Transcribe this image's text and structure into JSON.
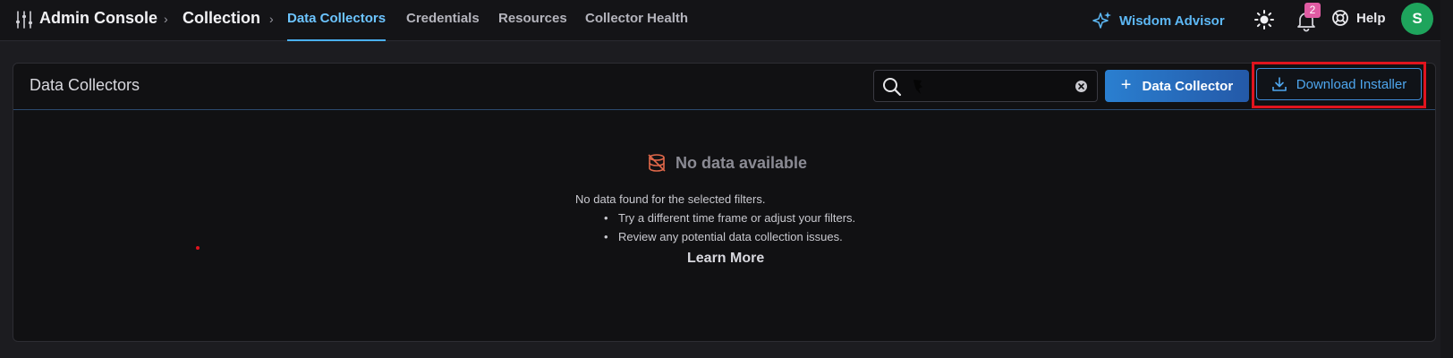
{
  "header": {
    "breadcrumb": {
      "app": "Admin Console",
      "section": "Collection"
    },
    "tabs": [
      {
        "label": "Data Collectors",
        "active": true
      },
      {
        "label": "Credentials",
        "active": false
      },
      {
        "label": "Resources",
        "active": false
      },
      {
        "label": "Collector Health",
        "active": false
      }
    ],
    "advisor_label": "Wisdom Advisor",
    "notifications_count": "2",
    "help_label": "Help",
    "avatar_initial": "S"
  },
  "panel": {
    "title": "Data Collectors",
    "search": {
      "value": "",
      "placeholder": ""
    },
    "add_button_label": "Data Collector",
    "download_button_label": "Download Installer"
  },
  "empty_state": {
    "title": "No data available",
    "description": "No data found for the selected filters.",
    "suggestions": [
      "Try a different time frame or adjust your filters.",
      "Review any potential data collection issues."
    ],
    "link_label": "Learn More"
  },
  "colors": {
    "accent": "#4ab0f5",
    "primary_button": "#2a7fd0",
    "highlight": "#e0141e",
    "avatar": "#1ea45c",
    "badge": "#e05ba3",
    "empty_icon": "#e0684a"
  },
  "icons": [
    "sliders-menu-icon",
    "chevron-right-icon",
    "sparkle-icon",
    "sun-icon",
    "bell-icon",
    "lifebuoy-icon",
    "search-icon",
    "clear-icon",
    "plus-icon",
    "download-icon",
    "no-data-icon"
  ]
}
